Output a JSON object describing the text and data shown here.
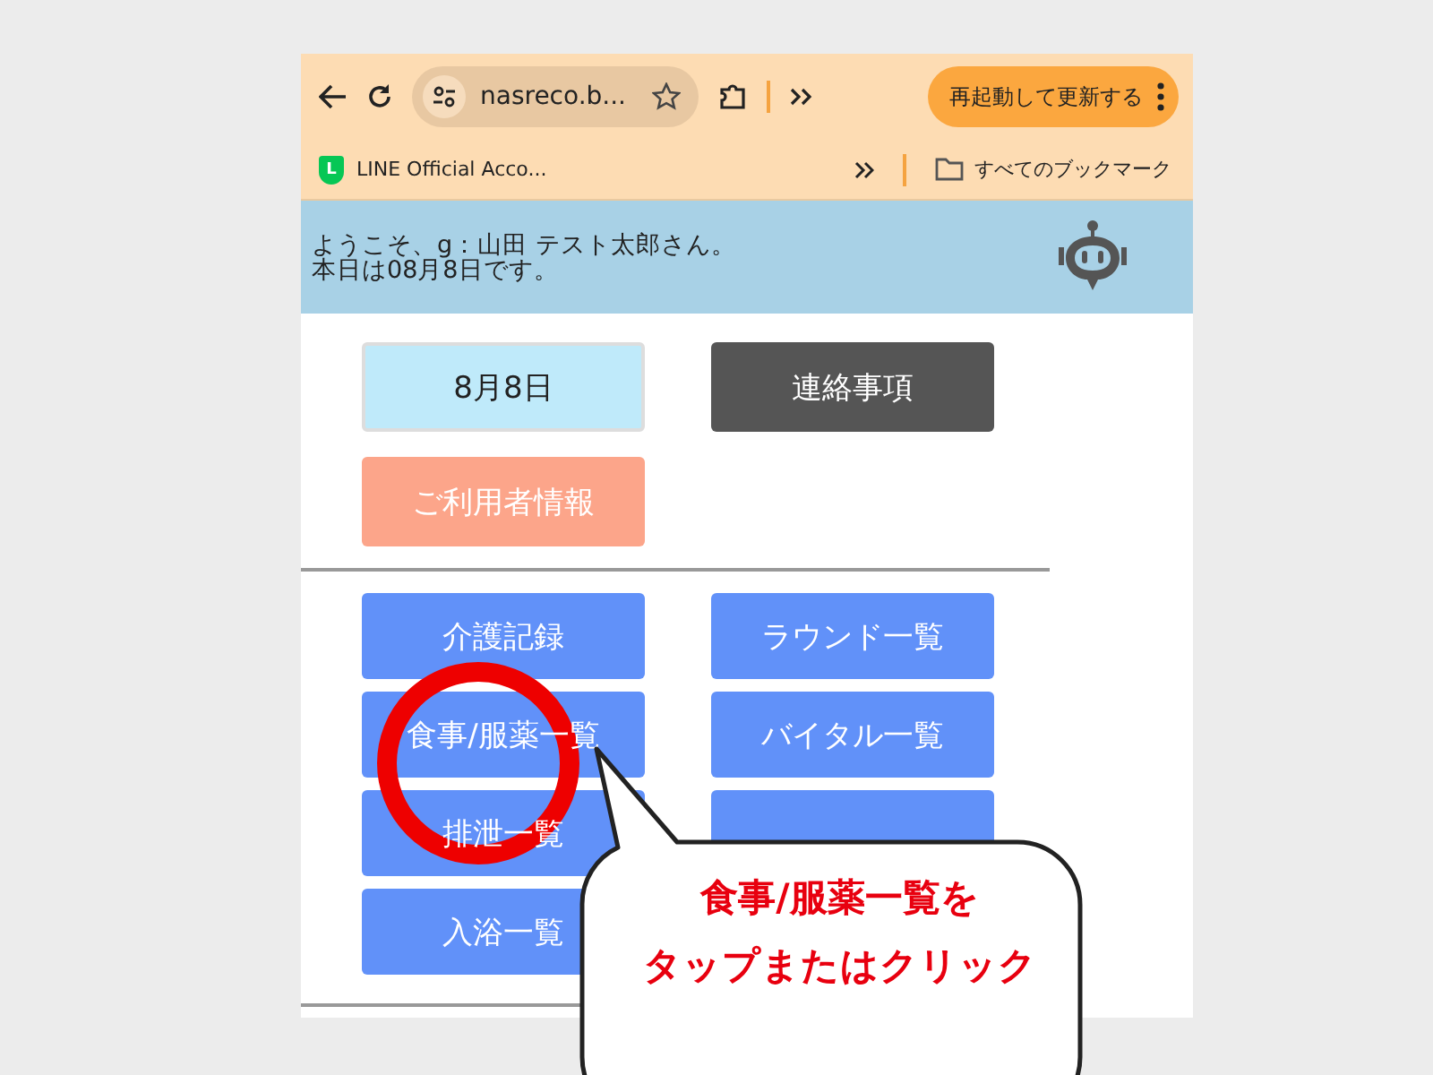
{
  "browser": {
    "url": "nasreco.b...",
    "update_button": "再起動して更新する",
    "bookmark": {
      "icon_text": "L",
      "label": "LINE Official Acco..."
    },
    "all_bookmarks": "すべてのブックマーク"
  },
  "header": {
    "lines": [
      "ようこそ、g：山田 テスト太郎さん。",
      "本日は08月8日です。"
    ]
  },
  "top_buttons": [
    {
      "label": "8月8日",
      "kind": "date"
    },
    {
      "label": "連絡事項",
      "kind": "notice"
    },
    {
      "label": "ご利用者情報",
      "kind": "user"
    }
  ],
  "menu_buttons": [
    {
      "label": "介護記録",
      "kind": "menu"
    },
    {
      "label": "ラウンド一覧",
      "kind": "menu"
    },
    {
      "label": "食事/服薬一覧",
      "kind": "menu"
    },
    {
      "label": "バイタル一覧",
      "kind": "menu"
    },
    {
      "label": "排泄一覧",
      "kind": "menu"
    },
    {
      "kind": "menu"
    },
    {
      "label": "入浴一覧",
      "kind": "menu"
    }
  ],
  "callout": {
    "lines": [
      "食事/服薬一覧を",
      "タップまたはクリック"
    ]
  }
}
